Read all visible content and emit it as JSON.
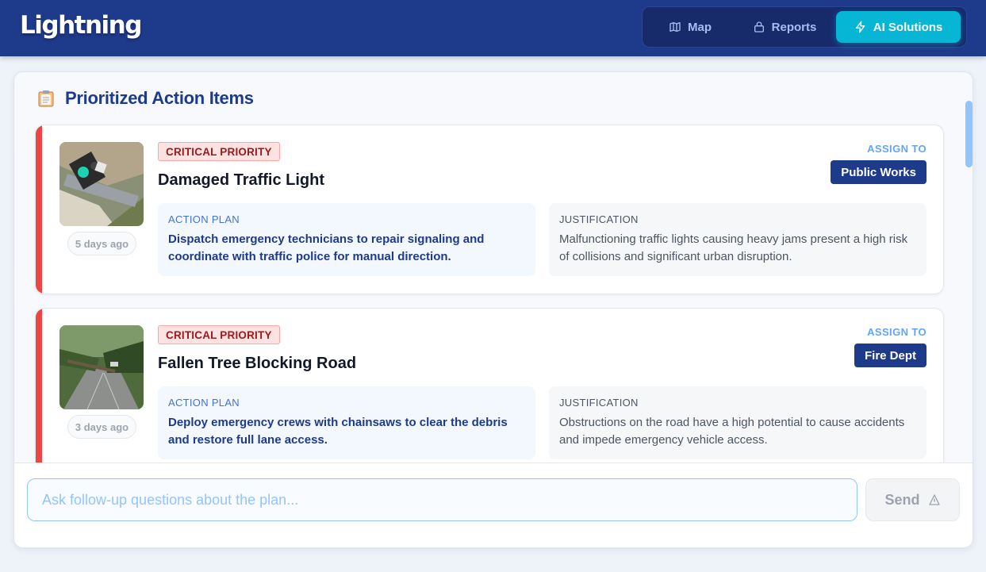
{
  "app": {
    "logo": "Lightning"
  },
  "nav": {
    "items": [
      {
        "label": "Map",
        "icon": "map-icon",
        "active": false
      },
      {
        "label": "Reports",
        "icon": "lock-icon",
        "active": false
      },
      {
        "label": "AI Solutions",
        "icon": "lightning-icon",
        "active": true
      }
    ]
  },
  "section": {
    "title": "Prioritized Action Items",
    "icon": "clipboard-icon"
  },
  "items": [
    {
      "priority": "CRITICAL PRIORITY",
      "title": "Damaged Traffic Light",
      "age": "5 days ago",
      "assign_label": "ASSIGN TO",
      "assignee": "Public Works",
      "plan_label": "ACTION PLAN",
      "plan_text": "Dispatch emergency technicians to repair signaling and coordinate with traffic police for manual direction.",
      "justification_label": "JUSTIFICATION",
      "justification_text": "Malfunctioning traffic lights causing heavy jams present a high risk of collisions and significant urban disruption."
    },
    {
      "priority": "CRITICAL PRIORITY",
      "title": "Fallen Tree Blocking Road",
      "age": "3 days ago",
      "assign_label": "ASSIGN TO",
      "assignee": "Fire Dept",
      "plan_label": "ACTION PLAN",
      "plan_text": "Deploy emergency crews with chainsaws to clear the debris and restore full lane access.",
      "justification_label": "JUSTIFICATION",
      "justification_text": "Obstructions on the road have a high potential to cause accidents and impede emergency vehicle access."
    }
  ],
  "chat": {
    "placeholder": "Ask follow-up questions about the plan...",
    "send_label": "Send",
    "send_icon": "send-icon"
  },
  "colors": {
    "header": "#1e3a8a",
    "accent_active": "#06b6d4",
    "critical": "#ef4444",
    "assignee_chip": "#1e3a8a"
  }
}
